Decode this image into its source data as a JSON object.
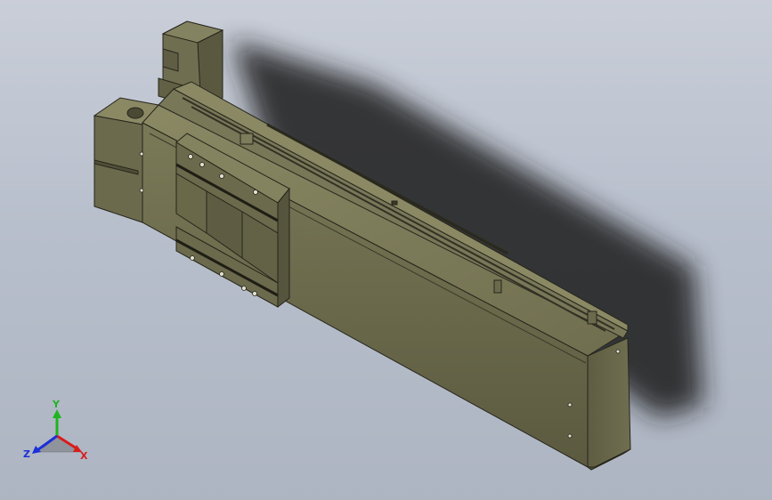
{
  "viewport": {
    "background_top": "#c9ced8",
    "background_bottom": "#aeb5c2",
    "part_color": "#6b6a4c",
    "part_edge_color": "#2b2a1e"
  },
  "triad": {
    "x_label": "X",
    "y_label": "Y",
    "z_label": "Z",
    "x_color": "#d81c1c",
    "y_color": "#1fb51f",
    "z_color": "#1c2fd8"
  }
}
